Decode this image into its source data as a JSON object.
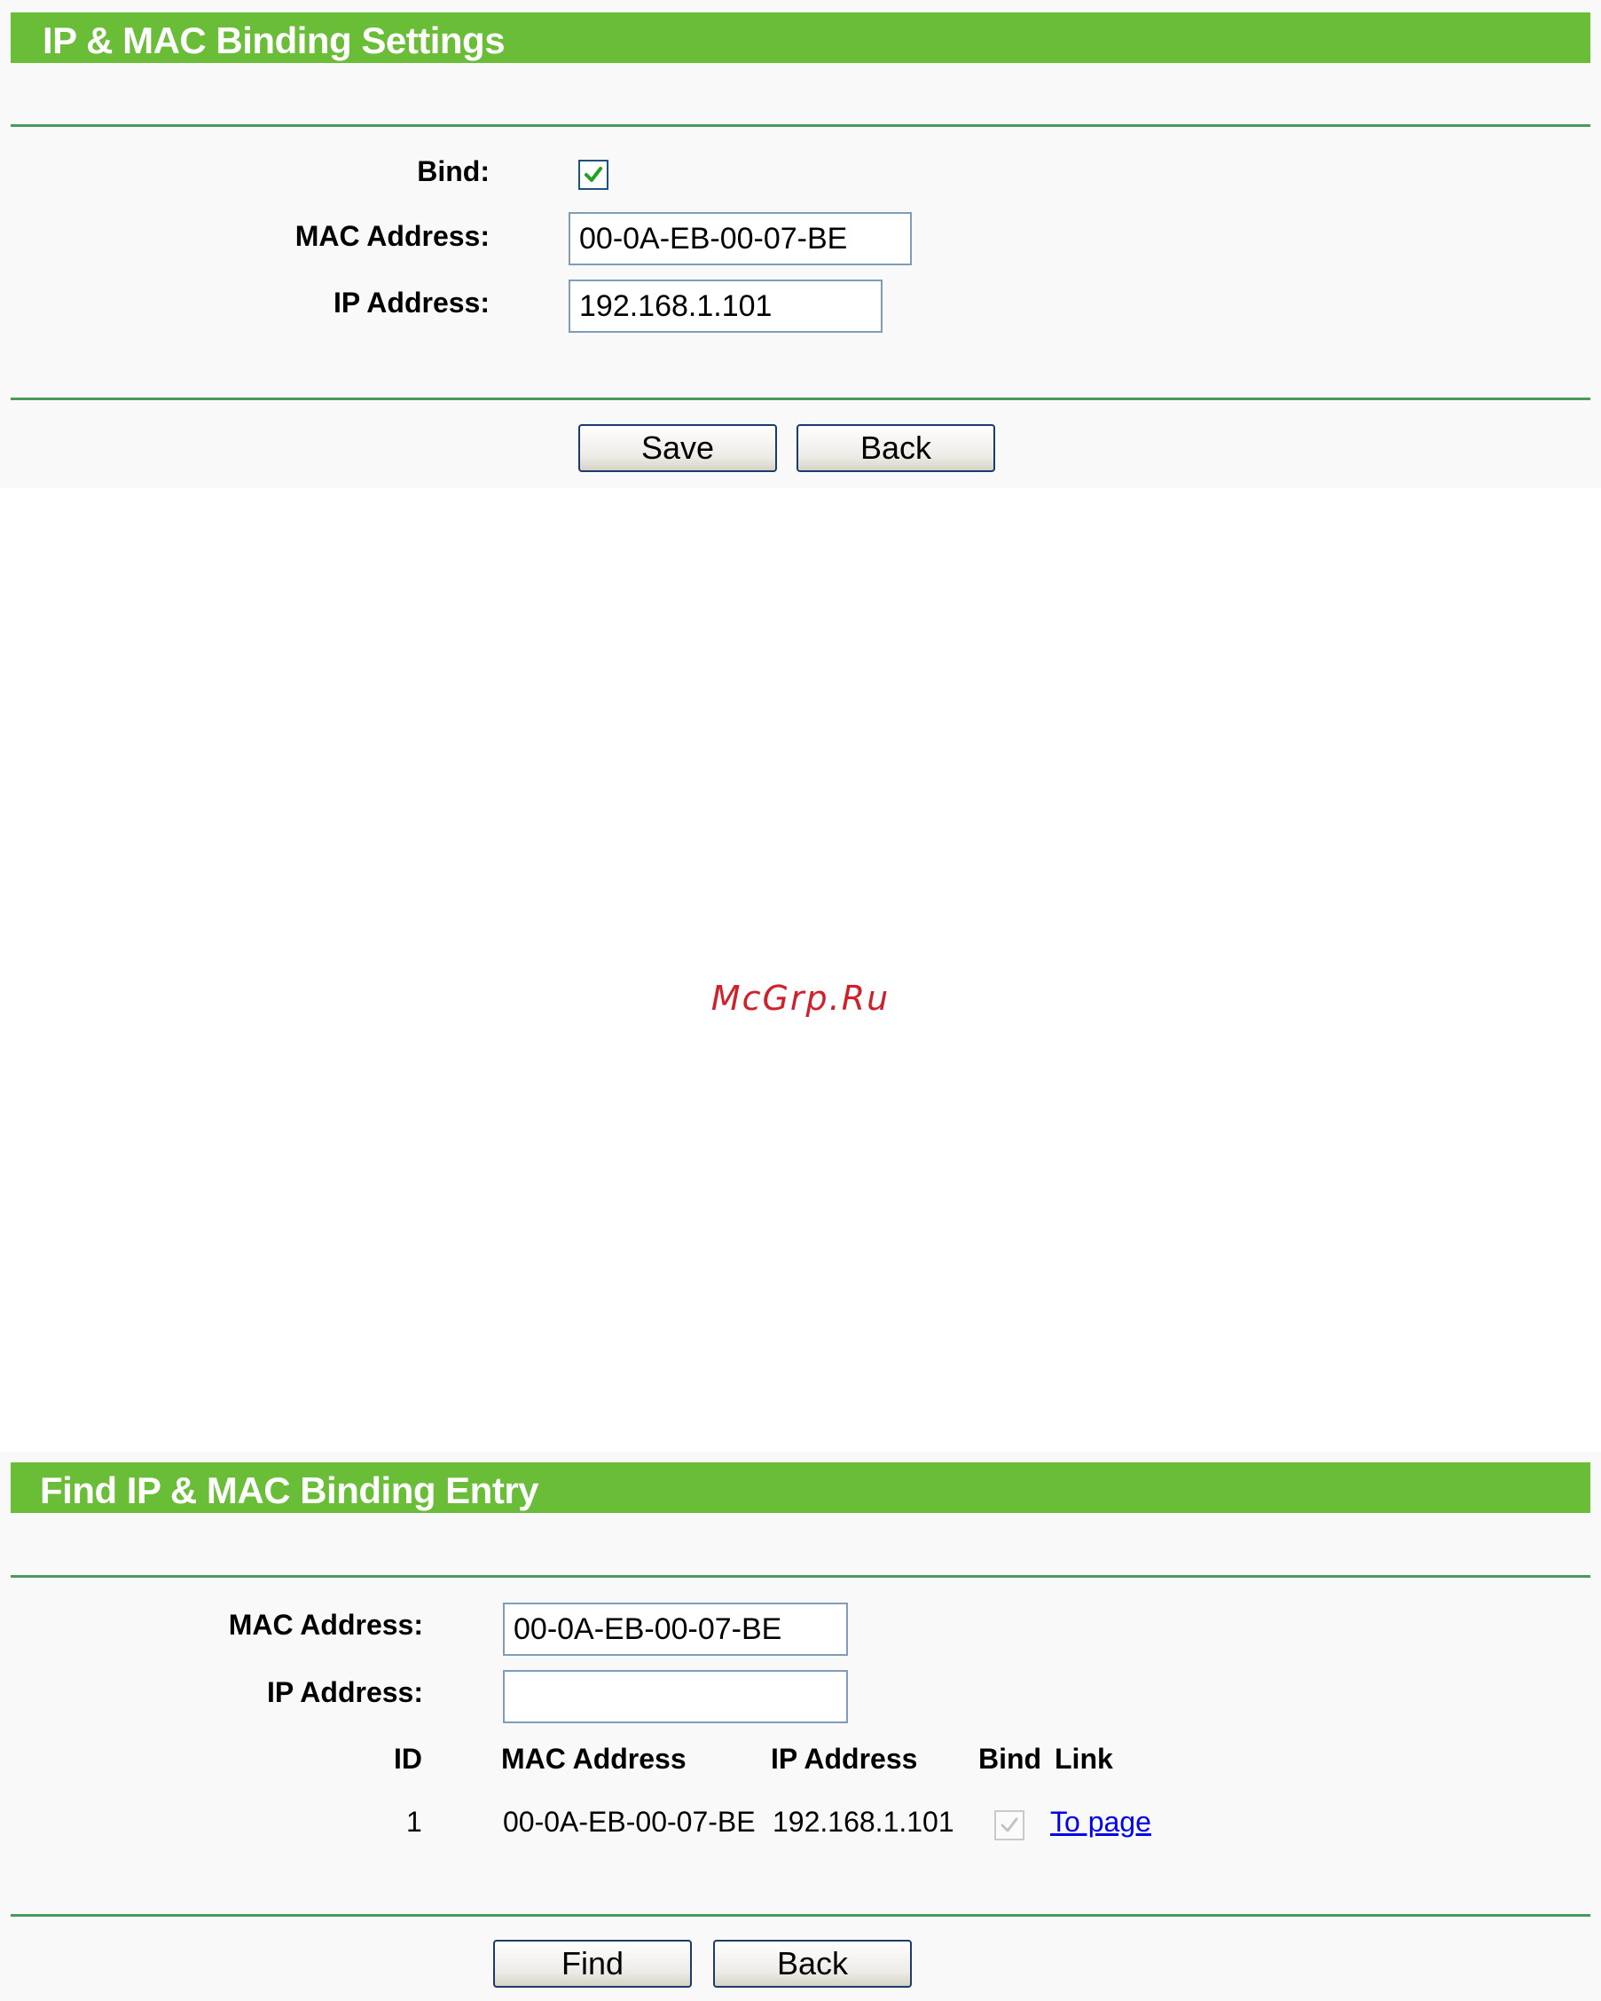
{
  "binding_settings": {
    "title": "IP & MAC Binding Settings",
    "bind_label": "Bind:",
    "bind_checked": true,
    "mac_label": "MAC Address:",
    "mac_value": "00-0A-EB-00-07-BE",
    "ip_label": "IP Address:",
    "ip_value": "192.168.1.101",
    "save_label": "Save",
    "back_label": "Back"
  },
  "watermark": "McGrp.Ru",
  "find_entry": {
    "title": "Find IP & MAC Binding Entry",
    "mac_label": "MAC Address:",
    "mac_value": "00-0A-EB-00-07-BE",
    "ip_label": "IP Address:",
    "ip_value": "",
    "columns": [
      "ID",
      "MAC Address",
      "IP Address",
      "Bind",
      "Link"
    ],
    "rows": [
      {
        "id": "1",
        "mac": "00-0A-EB-00-07-BE",
        "ip": "192.168.1.101",
        "bind": true,
        "link": "To page"
      }
    ],
    "find_label": "Find",
    "back_label": "Back"
  },
  "colors": {
    "title_bar": "#6abd36",
    "divider": "#4a9a5e",
    "link": "#0000ee",
    "watermark": "#d0202a"
  }
}
